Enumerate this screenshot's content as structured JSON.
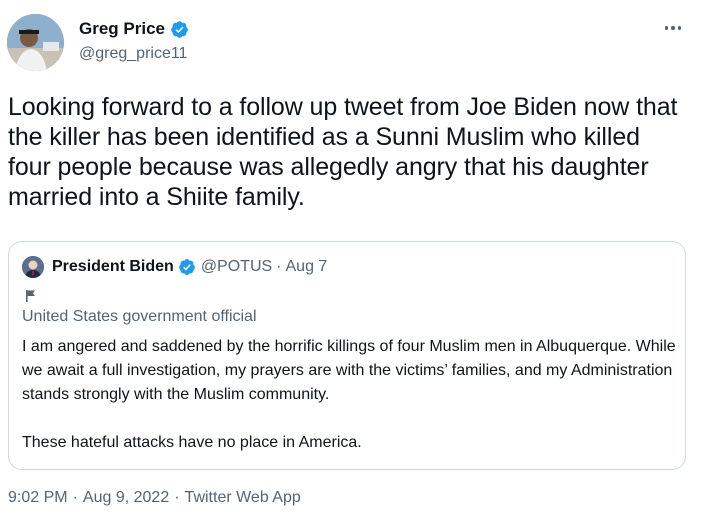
{
  "author": {
    "name": "Greg Price",
    "handle": "@greg_price11",
    "verified": true
  },
  "tweet": {
    "text": "Looking forward to a follow up tweet from Joe Biden now that the killer has been identified as a Sunni Muslim who killed four people because was allegedly angry that his daughter married into a Shiite family."
  },
  "quoted_tweet": {
    "name": "President Biden",
    "handle": "@POTUS",
    "separator": "·",
    "date": "Aug 7",
    "verified": true,
    "affiliation": "United States government official",
    "body": [
      "I am angered and saddened by the horrific killings of four Muslim men in Albuquerque. While we await a full investigation, my prayers are with the victims’ families, and my Administration stands strongly with the Muslim community.",
      "These hateful attacks have no place in America."
    ]
  },
  "meta": {
    "time": "9:02 PM",
    "separator": "·",
    "date": "Aug 9, 2022",
    "source": "Twitter Web App"
  },
  "colors": {
    "text": "#0f1419",
    "secondary": "#536471",
    "verified_blue": "#1d9bf0",
    "border": "#cfd9de"
  },
  "icons": {
    "verified": "verified-badge-icon",
    "more": "more-dots-icon",
    "flag": "flag-icon"
  }
}
